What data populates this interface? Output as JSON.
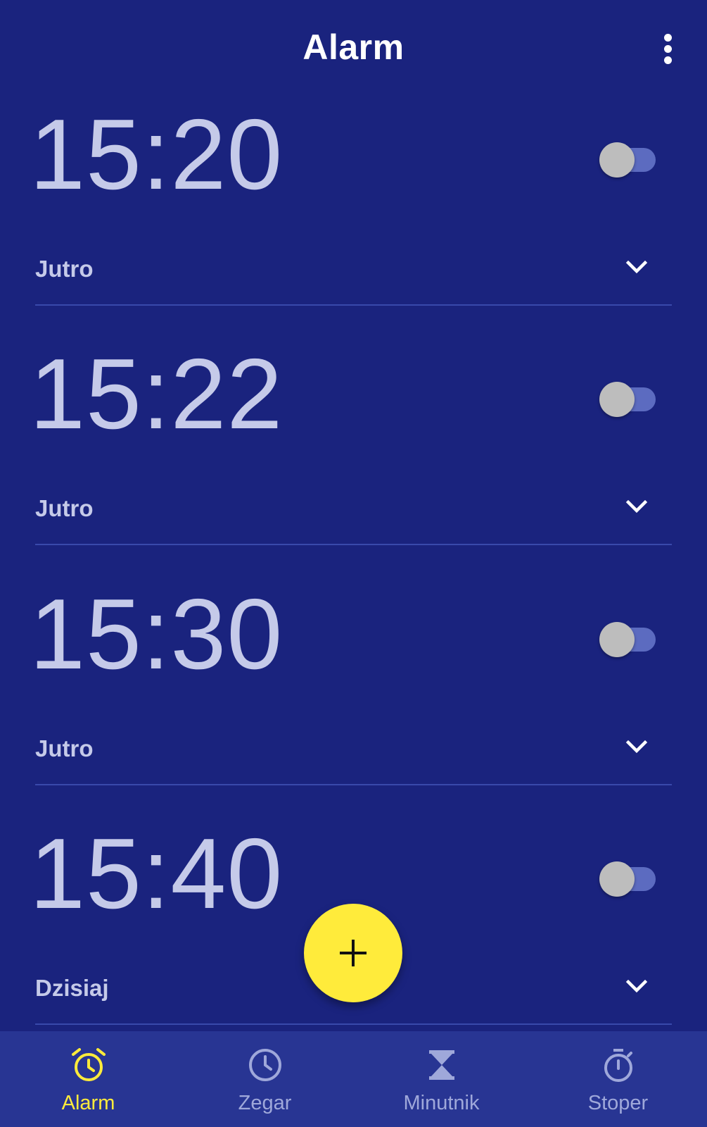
{
  "app_bar": {
    "title": "Alarm",
    "menu_icon": "more-vert-icon"
  },
  "alarms": [
    {
      "time": "15:20",
      "day": "Jutro",
      "enabled": false
    },
    {
      "time": "15:22",
      "day": "Jutro",
      "enabled": false
    },
    {
      "time": "15:30",
      "day": "Jutro",
      "enabled": false
    },
    {
      "time": "15:40",
      "day": "Dzisiaj",
      "enabled": false
    }
  ],
  "fab": {
    "icon": "plus-icon"
  },
  "bottom_nav": {
    "items": [
      {
        "label": "Alarm",
        "icon": "alarm-clock-icon",
        "active": true
      },
      {
        "label": "Zegar",
        "icon": "clock-icon",
        "active": false
      },
      {
        "label": "Minutnik",
        "icon": "hourglass-icon",
        "active": false
      },
      {
        "label": "Stoper",
        "icon": "stopwatch-icon",
        "active": false
      }
    ]
  },
  "colors": {
    "background": "#1a237e",
    "nav_background": "#283593",
    "accent": "#ffeb3b",
    "time_text": "#c5cae9",
    "inactive_nav": "#9fa8da"
  }
}
